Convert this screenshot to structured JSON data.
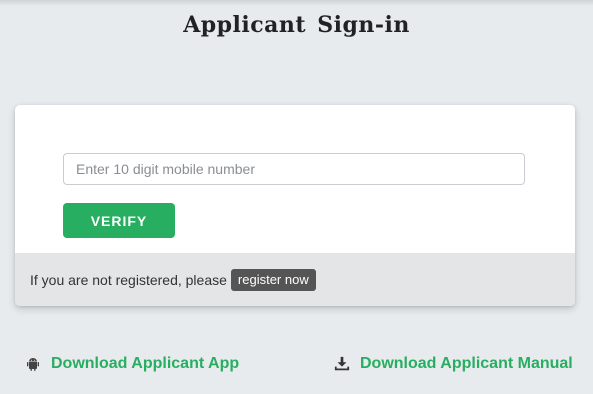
{
  "header": {
    "title": "Applicant Sign-in"
  },
  "signin": {
    "mobile_placeholder": "Enter 10 digit mobile number",
    "mobile_value": "",
    "verify_label": "VERIFY",
    "register_prompt": "If you are not registered, please",
    "register_label": "register now"
  },
  "downloads": {
    "app_label": "Download Applicant App",
    "app_icon": "android-icon",
    "manual_label": "Download Applicant Manual",
    "manual_icon": "download-icon"
  },
  "colors": {
    "accent_green": "#27ae60",
    "page_background": "#e7ebee",
    "register_button": "#555555"
  }
}
